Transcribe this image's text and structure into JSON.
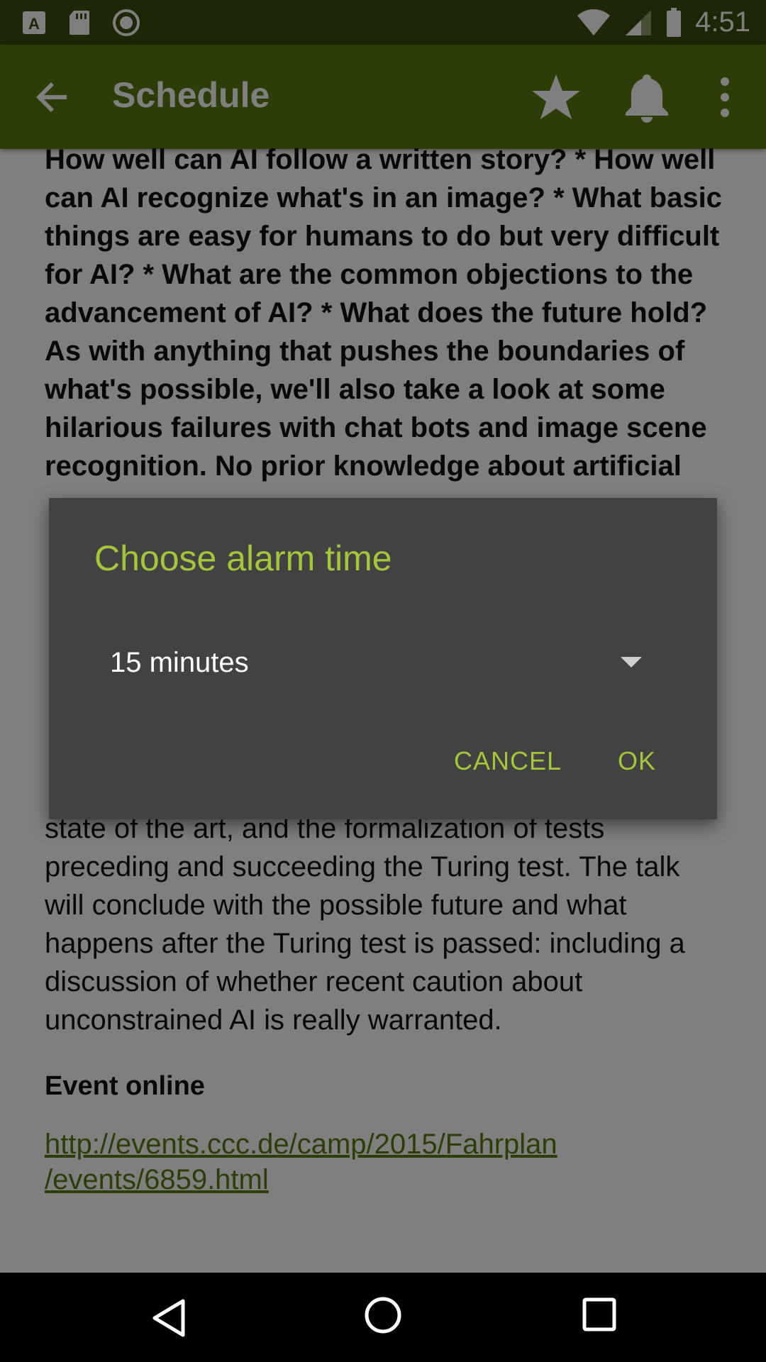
{
  "status_bar": {
    "time": "4:51",
    "left_icons": [
      "a-notification-icon",
      "sd-card-icon",
      "record-icon"
    ],
    "right_icons": [
      "wifi-icon",
      "signal-icon",
      "battery-icon"
    ]
  },
  "app_bar": {
    "title": "Schedule",
    "back_icon": "arrow-back-icon",
    "actions": [
      "star-icon",
      "bell-icon",
      "more-vert-icon"
    ]
  },
  "content": {
    "abstract": "How well can AI follow a written story? * How well can AI recognize what's in an image? * What basic things are easy for humans to do but very difficult for AI? * What are the common objections to the advancement of AI? * What does the future hold? As with anything that pushes the boundaries of what's possible, we'll also take a look at some hilarious failures with chat bots and image scene recognition. No prior knowledge about artificial intelligence is required for this talk.",
    "description_tail": "state of the art, and the formalization of tests preceding and succeeding the Turing test. The talk will conclude with the possible future and what happens after the Turing test is passed: including a discussion of whether recent caution about unconstrained AI is really warranted.",
    "event_online_label": "Event online",
    "event_link": "http://events.ccc.de/camp/2015/Fahrplan/events/6859.html",
    "event_link_line1": "http://events.ccc.de/camp/2015/Fahrplan",
    "event_link_line2": "/events/6859.html"
  },
  "dialog": {
    "title": "Choose alarm time",
    "selected_value": "15 minutes",
    "cancel_label": "CANCEL",
    "ok_label": "OK"
  },
  "colors": {
    "status_bar": "#3a4d0c",
    "app_bar": "#5a7a10",
    "accent": "#a4c639",
    "dialog_bg": "#424242",
    "link": "#5a7a10"
  },
  "nav_bar": {
    "icons": [
      "nav-back-icon",
      "nav-home-icon",
      "nav-recents-icon"
    ]
  }
}
